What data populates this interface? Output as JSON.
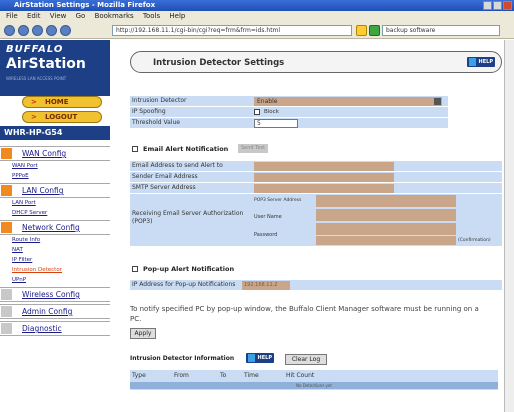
{
  "window": {
    "title": "AirStation Settings - Mozilla Firefox"
  },
  "menubar": {
    "items": [
      "File",
      "Edit",
      "View",
      "Go",
      "Bookmarks",
      "Tools",
      "Help"
    ]
  },
  "navbar": {
    "url": "http://192.168.11.1/cgi-bin/cgi?req=frm&frm=ids.html",
    "search": "backup software"
  },
  "sidebar": {
    "brand": "BUFFALO",
    "product": "AirStation",
    "tagline": "WIRELESS LAN ACCESS POINT",
    "home_label": "HOME",
    "logout_label": "LOGOUT",
    "model": "WHR-HP-G54",
    "sections": [
      {
        "label": "WAN Config",
        "subs": [
          "WAN Port",
          "PPPoE"
        ]
      },
      {
        "label": "LAN Config",
        "subs": [
          "LAN Port",
          "DHCP Server"
        ]
      },
      {
        "label": "Network Config",
        "subs": [
          "Route Info",
          "NAT",
          "IP Filter",
          "Intrusion Detector",
          "UPnP"
        ]
      },
      {
        "label": "Wireless Config",
        "subs": []
      },
      {
        "label": "Admin Config",
        "subs": []
      },
      {
        "label": "Diagnostic",
        "subs": []
      }
    ]
  },
  "main": {
    "title": "Intrusion Detector Settings",
    "help_label": "HELP",
    "intrusion_detector_label": "Intrusion Detector",
    "intrusion_detector_value": "Enable",
    "ip_spoofing_label": "IP Spoofing",
    "ip_spoofing_value": "Block",
    "threshold_label": "Threshold Value",
    "threshold_value": "5",
    "email_section": "Email Alert Notification",
    "send_test_label": "Send Test",
    "email_to_label": "Email Address to send Alert to",
    "sender_label": "Sender Email Address",
    "smtp_label": "SMTP Server Address",
    "pop3_label": "Receiving Email Server Authorization (POP3)",
    "pop3_server_label": "POP3 Server Address",
    "user_name_label": "User Name",
    "password_label": "Password",
    "confirmation_label": "(Confirmation)",
    "popup_section": "Pop-up Alert Notification",
    "popup_ip_label": "IP Address for Pop-up Notifications",
    "popup_ip_value": "192.168.11.2",
    "note": "To notify specified PC by pop-up window, the Buffalo Client Manager software must be running on a PC.",
    "apply_label": "Apply",
    "info_title": "Intrusion Detector Information",
    "clear_log_label": "Clear Log",
    "log_headers": [
      "Type",
      "From",
      "To",
      "Time",
      "Hit Count"
    ],
    "log_empty": "No Detections yet"
  }
}
